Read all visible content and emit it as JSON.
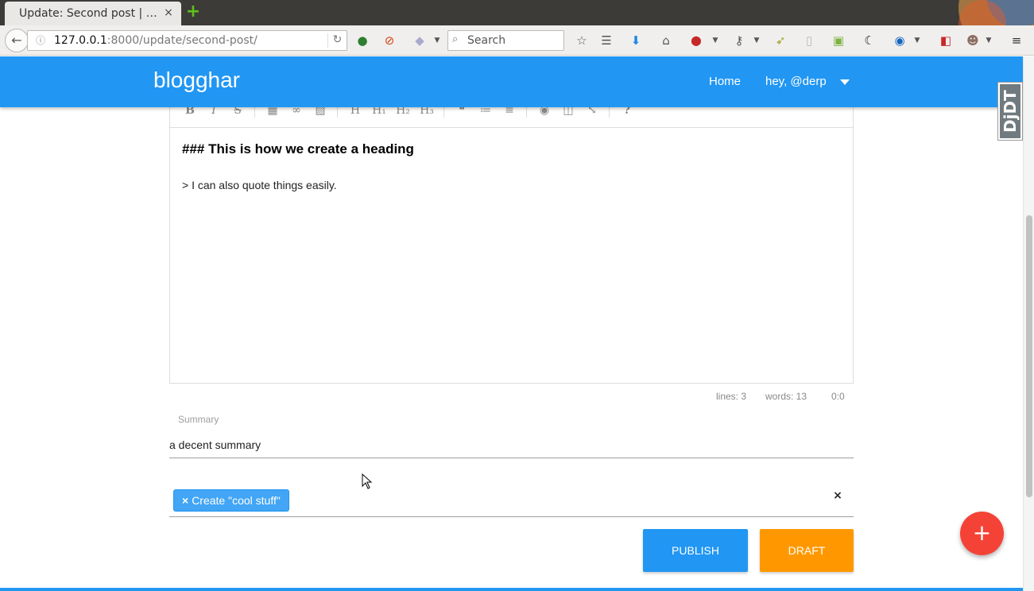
{
  "browser": {
    "tab_title": "Update: Second post | …",
    "tab_close": "×",
    "new_tab": "+",
    "url_host": "127.0.0.1",
    "url_rest": ":8000/update/second-post/",
    "search_placeholder": "Search"
  },
  "appbar": {
    "brand": "blogghar",
    "home_link": "Home",
    "user_menu": "hey, @derp"
  },
  "djdt_label": "DjDT",
  "editor": {
    "content_heading": "### This is how we create a heading",
    "content_quote": "> I can also quote things easily.",
    "status_lines": "lines: 3",
    "status_words": "words: 13",
    "status_cursor": "0:0",
    "toolbar": {
      "bold": "B",
      "italic": "I",
      "strike": "S",
      "h": "H",
      "h1": "H₁",
      "h2": "H₂",
      "h3": "H₃",
      "help": "?"
    }
  },
  "summary": {
    "label": "Summary",
    "value": "a decent summary"
  },
  "tags": {
    "chip_remove": "×",
    "chip_label": "Create \"cool stuff\"",
    "clear": "×"
  },
  "actions": {
    "publish": "PUBLISH",
    "draft": "DRAFT",
    "fab": "+"
  },
  "colors": {
    "primary": "#2196f3",
    "draft": "#ff9800",
    "fab": "#f44336"
  }
}
